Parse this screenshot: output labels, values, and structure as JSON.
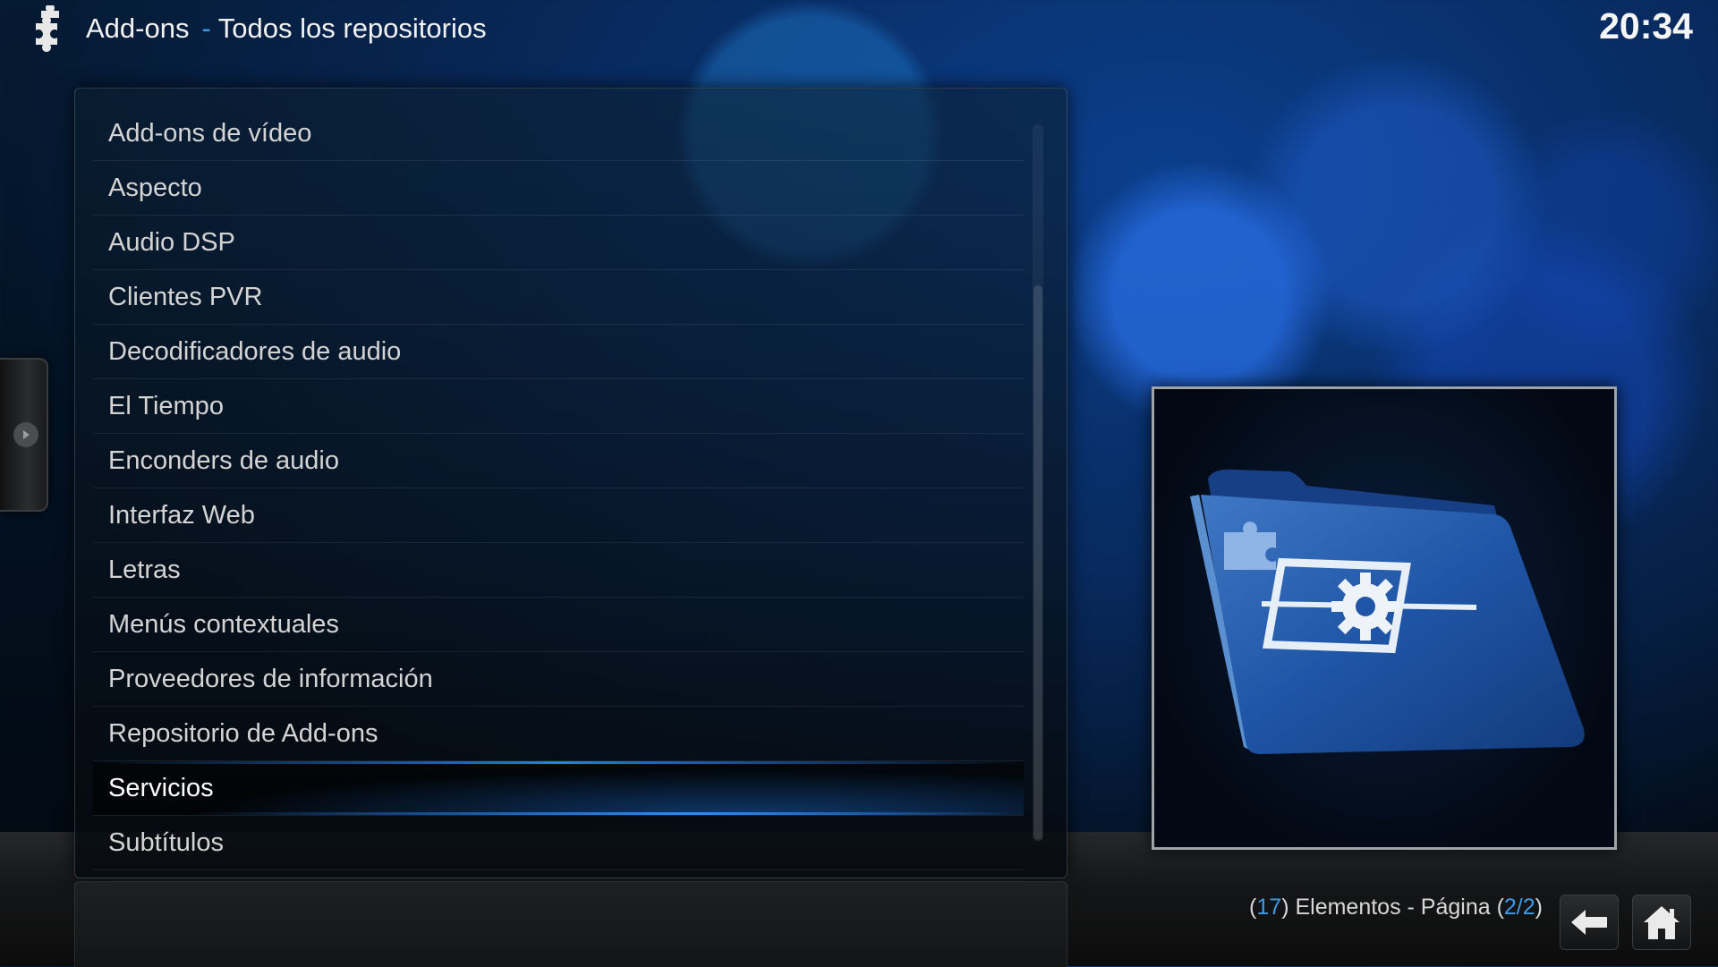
{
  "header": {
    "title": "Add-ons",
    "separator": "-",
    "subtitle": "Todos los repositorios",
    "logo_icon": "addon-puzzle-icon"
  },
  "clock": "20:34",
  "list": {
    "items": [
      {
        "label": "Add-ons de vídeo"
      },
      {
        "label": "Aspecto"
      },
      {
        "label": "Audio DSP"
      },
      {
        "label": "Clientes PVR"
      },
      {
        "label": "Decodificadores de audio"
      },
      {
        "label": "El Tiempo"
      },
      {
        "label": "Enconders de audio"
      },
      {
        "label": "Interfaz Web"
      },
      {
        "label": "Letras"
      },
      {
        "label": "Menús contextuales"
      },
      {
        "label": "Proveedores de información"
      },
      {
        "label": "Repositorio de Add-ons"
      },
      {
        "label": "Servicios"
      },
      {
        "label": "Subtítulos"
      }
    ],
    "focused_label": "Servicios"
  },
  "preview": {
    "icon": "addon-services-folder-icon"
  },
  "footer": {
    "open_paren": "(",
    "count": "17",
    "count_text": ") Elementos - Página (",
    "page": "2/2",
    "close_paren": ")",
    "back_icon": "back-arrow-icon",
    "home_icon": "home-icon"
  },
  "colors": {
    "accent": "#3f9ae8",
    "focus_glow": "#288cff"
  }
}
